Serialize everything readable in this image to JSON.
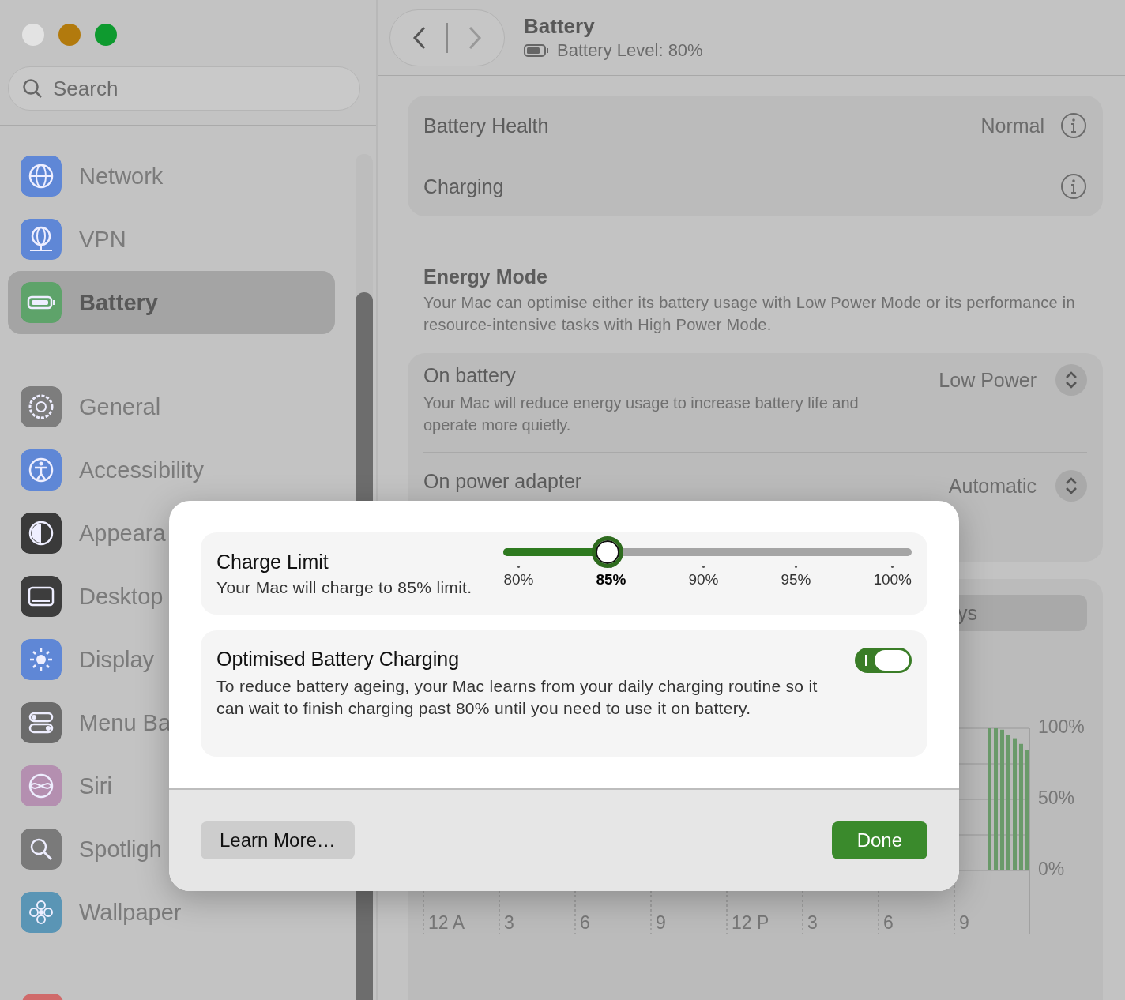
{
  "search": {
    "placeholder": "Search"
  },
  "sidebar": {
    "items": [
      {
        "label": "Network",
        "selected": false
      },
      {
        "label": "VPN",
        "selected": false
      },
      {
        "label": "Battery",
        "selected": true
      },
      {
        "label": "General",
        "selected": false
      },
      {
        "label": "Accessibility",
        "selected": false
      },
      {
        "label": "Appeara",
        "selected": false
      },
      {
        "label": "Desktop",
        "selected": false
      },
      {
        "label": "Display",
        "selected": false
      },
      {
        "label": "Menu Ba",
        "selected": false
      },
      {
        "label": "Siri",
        "selected": false
      },
      {
        "label": "Spotligh",
        "selected": false
      },
      {
        "label": "Wallpaper",
        "selected": false
      }
    ]
  },
  "toolbar": {
    "back_enabled": true,
    "forward_enabled": false,
    "title": "Battery",
    "subtitle": "Battery Level: 80%"
  },
  "health_card": {
    "rows": [
      {
        "label": "Battery Health",
        "value": "Normal"
      },
      {
        "label": "Charging"
      }
    ]
  },
  "energy_mode": {
    "title": "Energy Mode",
    "description": "Your Mac can optimise either its battery usage with Low Power Mode or its performance in resource-intensive tasks with High Power Mode.",
    "rows": [
      {
        "label": "On battery",
        "value": "Low Power",
        "description": "Your Mac will reduce energy usage to increase battery life and operate more quietly."
      },
      {
        "label": "On power adapter",
        "value": "Automatic"
      }
    ]
  },
  "usage": {
    "segment_label": "ys",
    "y_labels": [
      "100%",
      "50%",
      "0%"
    ],
    "x_labels": [
      "12 A",
      "3",
      "6",
      "9",
      "12 P",
      "3",
      "6",
      "9"
    ]
  },
  "dialog": {
    "charge_limit": {
      "title": "Charge Limit",
      "description": "Your Mac will charge to 85% limit.",
      "level": 0.25,
      "ticks": [
        {
          "label": "80%",
          "selected": false
        },
        {
          "label": "85%",
          "selected": true
        },
        {
          "label": "90%",
          "selected": false
        },
        {
          "label": "95%",
          "selected": false
        },
        {
          "label": "100%",
          "selected": false
        }
      ]
    },
    "optimised": {
      "title": "Optimised Battery Charging",
      "description": "To reduce battery ageing, your Mac learns from your daily charging routine so it can wait to finish charging past 80% until you need to use it on battery.",
      "on": true
    },
    "buttons": [
      {
        "label": "Learn More…",
        "kind": "secondary"
      },
      {
        "label": "Done",
        "kind": "primary"
      }
    ]
  }
}
